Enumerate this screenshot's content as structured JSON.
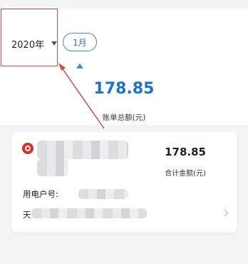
{
  "filter": {
    "year": "2020年",
    "month": "1月"
  },
  "summary": {
    "total_amount": "178.85",
    "total_label": "账单总额(元)"
  },
  "bill_card": {
    "amount": "178.85",
    "amount_label": "合计金额(元)",
    "account_label": "用电户号:",
    "name_label_prefix": "天"
  },
  "colors": {
    "accent": "#1f73c4",
    "annotation": "#d64a4a",
    "logo": "#d8302d"
  },
  "icons": [
    "year-dropdown-arrow-icon",
    "logo-icon",
    "chevron-right-icon"
  ]
}
